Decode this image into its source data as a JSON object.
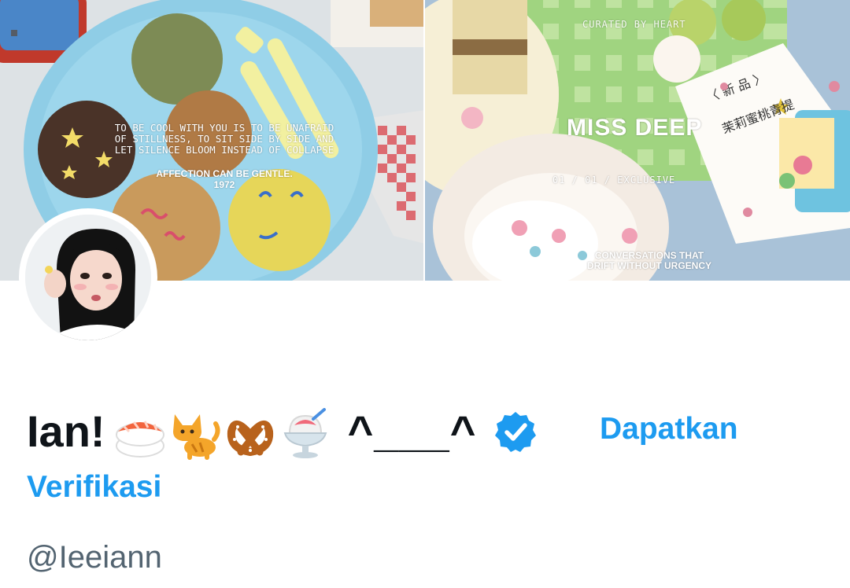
{
  "banner": {
    "left_quote": "TO BE COOL WITH YOU IS TO BE UNAFRAID\nOF STILLNESS, TO SIT SIDE BY SIDE AND\nLET SILENCE BLOOM INSTEAD OF COLLAPSE",
    "left_affection": "AFFECTION CAN BE GENTLE.\n1972",
    "right_curated": "CURATED BY HEART",
    "right_title": "MISS DEEP",
    "right_date": "01 / 01 / EXCLUSIVE",
    "right_conversations": "CONVERSATIONS THAT\nDRIFT WITHOUT URGENCY"
  },
  "profile": {
    "display_name": "Ian!",
    "name_emojis": [
      "sushi-emoji",
      "cat-emoji",
      "pretzel-emoji",
      "shaved-ice-emoji"
    ],
    "kaomoji": "^___^",
    "verified_badge_color": "#1d9bf0",
    "get_verified_line1": "Dapatkan",
    "get_verified_line2": "Verifikasi",
    "handle": "@Ieeiann"
  },
  "colors": {
    "text_primary": "#0f1419",
    "text_secondary": "#536471",
    "accent": "#1d9bf0"
  }
}
